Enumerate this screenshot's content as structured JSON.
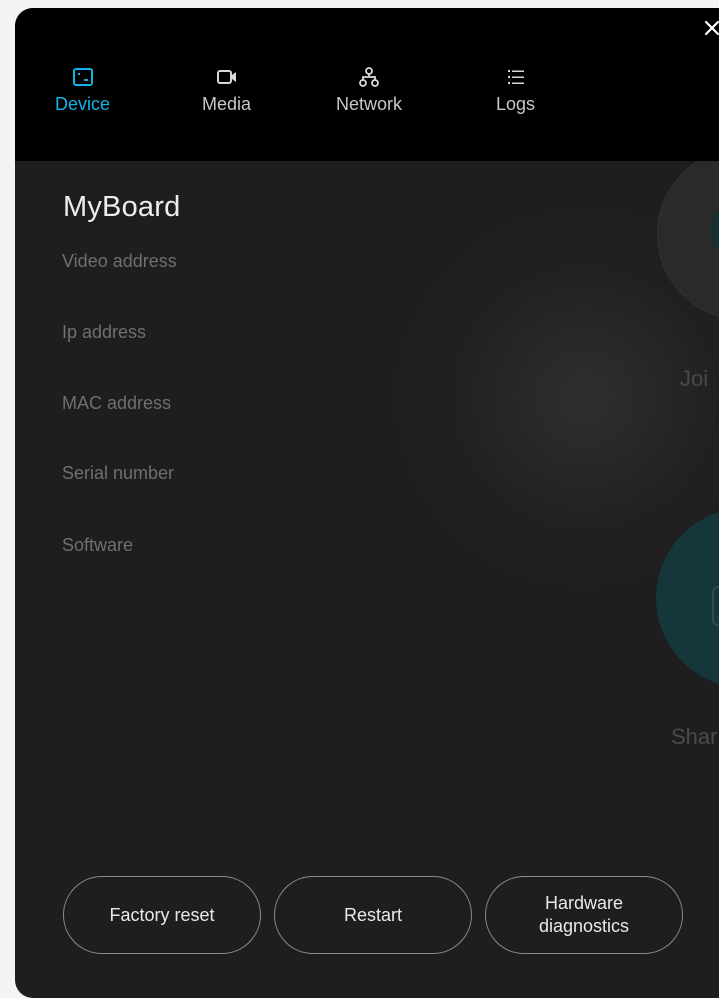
{
  "tabs": [
    {
      "label": "Device",
      "icon": "tablet-icon",
      "active": true
    },
    {
      "label": "Media",
      "icon": "video-camera-icon",
      "active": false
    },
    {
      "label": "Network",
      "icon": "network-icon",
      "active": false
    },
    {
      "label": "Logs",
      "icon": "list-icon",
      "active": false
    }
  ],
  "device": {
    "name": "MyBoard",
    "fields": [
      "Video address",
      "Ip address",
      "MAC address",
      "Serial number",
      "Software"
    ]
  },
  "actions": {
    "factory_reset": "Factory reset",
    "restart": "Restart",
    "hardware_diagnostics": "Hardware diagnostics"
  },
  "background": {
    "join_label": "Joi",
    "share_label": "Shar"
  },
  "colors": {
    "accent": "#12b3e6",
    "header_bg": "#000000",
    "panel_bg": "#1e1e1e"
  }
}
